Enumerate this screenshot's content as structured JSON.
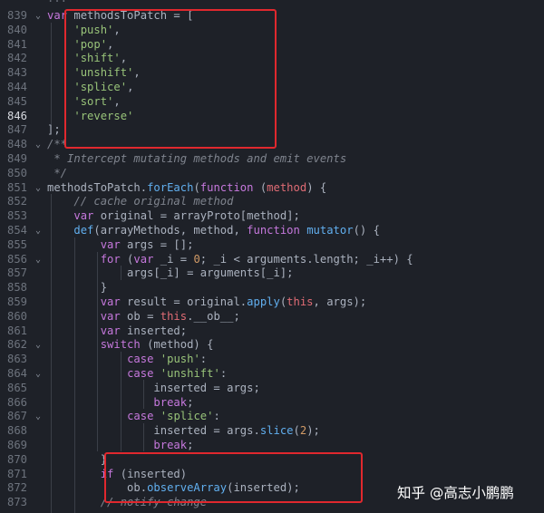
{
  "colors": {
    "background": "#1e2128",
    "keyword": "#c678dd",
    "function": "#61afef",
    "string": "#98c379",
    "comment": "#7f848e",
    "number": "#d19a66",
    "variable": "#e06c75",
    "plain": "#abb2bf",
    "highlight_box": "#e0282e"
  },
  "top_partial_text": "...",
  "active_line": 846,
  "lines": [
    {
      "no": "839",
      "fold": "v",
      "tokens": [
        [
          "var",
          "kw"
        ],
        [
          " methodsToPatch = [",
          "p"
        ]
      ]
    },
    {
      "no": "840",
      "tokens": [
        [
          "    ",
          "p"
        ],
        [
          "'push'",
          "s"
        ],
        [
          ",",
          "p"
        ]
      ]
    },
    {
      "no": "841",
      "tokens": [
        [
          "    ",
          "p"
        ],
        [
          "'pop'",
          "s"
        ],
        [
          ",",
          "p"
        ]
      ]
    },
    {
      "no": "842",
      "tokens": [
        [
          "    ",
          "p"
        ],
        [
          "'shift'",
          "s"
        ],
        [
          ",",
          "p"
        ]
      ]
    },
    {
      "no": "843",
      "tokens": [
        [
          "    ",
          "p"
        ],
        [
          "'unshift'",
          "s"
        ],
        [
          ",",
          "p"
        ]
      ]
    },
    {
      "no": "844",
      "tokens": [
        [
          "    ",
          "p"
        ],
        [
          "'splice'",
          "s"
        ],
        [
          ",",
          "p"
        ]
      ]
    },
    {
      "no": "845",
      "tokens": [
        [
          "    ",
          "p"
        ],
        [
          "'sort'",
          "s"
        ],
        [
          ",",
          "p"
        ]
      ]
    },
    {
      "no": "846",
      "tokens": [
        [
          "    ",
          "p"
        ],
        [
          "'reverse'",
          "s"
        ]
      ]
    },
    {
      "no": "847",
      "tokens": [
        [
          "];",
          "p"
        ]
      ]
    },
    {
      "no": "848",
      "fold": "v",
      "tokens": [
        [
          "/**",
          "c"
        ]
      ]
    },
    {
      "no": "849",
      "tokens": [
        [
          " * Intercept mutating methods and emit events",
          "c"
        ]
      ]
    },
    {
      "no": "850",
      "tokens": [
        [
          " */",
          "c"
        ]
      ]
    },
    {
      "no": "851",
      "fold": "v",
      "tokens": [
        [
          "methodsToPatch.",
          "p"
        ],
        [
          "forEach",
          "f"
        ],
        [
          "(",
          "p"
        ],
        [
          "function",
          "kw"
        ],
        [
          " (",
          "p"
        ],
        [
          "method",
          "v"
        ],
        [
          ") {",
          "p"
        ]
      ]
    },
    {
      "no": "852",
      "tokens": [
        [
          "    ",
          "p"
        ],
        [
          "// cache original method",
          "c"
        ]
      ]
    },
    {
      "no": "853",
      "tokens": [
        [
          "    ",
          "p"
        ],
        [
          "var",
          "kw"
        ],
        [
          " original = arrayProto[method];",
          "p"
        ]
      ]
    },
    {
      "no": "854",
      "fold": "v",
      "tokens": [
        [
          "    ",
          "p"
        ],
        [
          "def",
          "f"
        ],
        [
          "(arrayMethods, method, ",
          "p"
        ],
        [
          "function",
          "kw"
        ],
        [
          " ",
          "p"
        ],
        [
          "mutator",
          "f"
        ],
        [
          "() {",
          "p"
        ]
      ]
    },
    {
      "no": "855",
      "tokens": [
        [
          "        ",
          "p"
        ],
        [
          "var",
          "kw"
        ],
        [
          " args = [];",
          "p"
        ]
      ]
    },
    {
      "no": "856",
      "fold": "v",
      "tokens": [
        [
          "        ",
          "p"
        ],
        [
          "for",
          "kw"
        ],
        [
          " (",
          "p"
        ],
        [
          "var",
          "kw"
        ],
        [
          " _i = ",
          "p"
        ],
        [
          "0",
          "n"
        ],
        [
          "; _i < arguments.length; _i++) {",
          "p"
        ]
      ]
    },
    {
      "no": "857",
      "tokens": [
        [
          "            args[_i] = arguments[_i];",
          "p"
        ]
      ]
    },
    {
      "no": "858",
      "tokens": [
        [
          "        }",
          "p"
        ]
      ]
    },
    {
      "no": "859",
      "tokens": [
        [
          "        ",
          "p"
        ],
        [
          "var",
          "kw"
        ],
        [
          " result = original.",
          "p"
        ],
        [
          "apply",
          "f"
        ],
        [
          "(",
          "p"
        ],
        [
          "this",
          "v"
        ],
        [
          ", args);",
          "p"
        ]
      ]
    },
    {
      "no": "860",
      "tokens": [
        [
          "        ",
          "p"
        ],
        [
          "var",
          "kw"
        ],
        [
          " ob = ",
          "p"
        ],
        [
          "this",
          "v"
        ],
        [
          ".__ob__;",
          "p"
        ]
      ]
    },
    {
      "no": "861",
      "tokens": [
        [
          "        ",
          "p"
        ],
        [
          "var",
          "kw"
        ],
        [
          " inserted;",
          "p"
        ]
      ]
    },
    {
      "no": "862",
      "fold": "v",
      "tokens": [
        [
          "        ",
          "p"
        ],
        [
          "switch",
          "kw"
        ],
        [
          " (method) {",
          "p"
        ]
      ]
    },
    {
      "no": "863",
      "tokens": [
        [
          "            ",
          "p"
        ],
        [
          "case",
          "kw"
        ],
        [
          " ",
          "p"
        ],
        [
          "'push'",
          "s"
        ],
        [
          ":",
          "p"
        ]
      ]
    },
    {
      "no": "864",
      "fold": "v",
      "tokens": [
        [
          "            ",
          "p"
        ],
        [
          "case",
          "kw"
        ],
        [
          " ",
          "p"
        ],
        [
          "'unshift'",
          "s"
        ],
        [
          ":",
          "p"
        ]
      ]
    },
    {
      "no": "865",
      "tokens": [
        [
          "                inserted = args;",
          "p"
        ]
      ]
    },
    {
      "no": "866",
      "tokens": [
        [
          "                ",
          "p"
        ],
        [
          "break",
          "kw"
        ],
        [
          ";",
          "p"
        ]
      ]
    },
    {
      "no": "867",
      "fold": "v",
      "tokens": [
        [
          "            ",
          "p"
        ],
        [
          "case",
          "kw"
        ],
        [
          " ",
          "p"
        ],
        [
          "'splice'",
          "s"
        ],
        [
          ":",
          "p"
        ]
      ]
    },
    {
      "no": "868",
      "tokens": [
        [
          "                inserted = args.",
          "p"
        ],
        [
          "slice",
          "f"
        ],
        [
          "(",
          "p"
        ],
        [
          "2",
          "n"
        ],
        [
          ");",
          "p"
        ]
      ]
    },
    {
      "no": "869",
      "tokens": [
        [
          "                ",
          "p"
        ],
        [
          "break",
          "kw"
        ],
        [
          ";",
          "p"
        ]
      ]
    },
    {
      "no": "870",
      "tokens": [
        [
          "        }",
          "p"
        ]
      ]
    },
    {
      "no": "871",
      "tokens": [
        [
          "        ",
          "p"
        ],
        [
          "if",
          "kw"
        ],
        [
          " (inserted)",
          "p"
        ]
      ]
    },
    {
      "no": "872",
      "tokens": [
        [
          "            ob.",
          "p"
        ],
        [
          "observeArray",
          "f"
        ],
        [
          "(inserted);",
          "p"
        ]
      ]
    },
    {
      "no": "873",
      "tokens": [
        [
          "        ",
          "p"
        ],
        [
          "// notify change",
          "c"
        ]
      ]
    }
  ],
  "watermark": {
    "text": "知乎 @高志小鹏鹏"
  }
}
